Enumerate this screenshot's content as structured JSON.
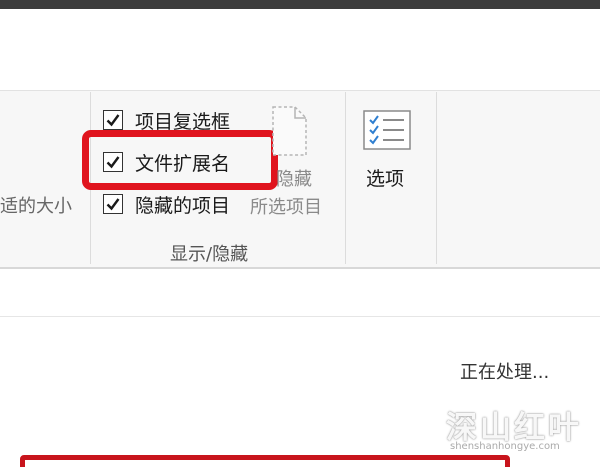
{
  "ribbon": {
    "partial_size_label": "适的大小",
    "show_hide_group": {
      "label": "显示/隐藏",
      "checkboxes": [
        {
          "label": "项目复选框",
          "checked": true
        },
        {
          "label": "文件扩展名",
          "checked": true,
          "highlighted": true
        },
        {
          "label": "隐藏的项目",
          "checked": true
        }
      ],
      "hide_selected": {
        "line1": "隐藏",
        "line2": "所选项目",
        "icon": "document-hide-icon"
      }
    },
    "options": {
      "label": "选项",
      "icon": "options-list-icon"
    }
  },
  "status": {
    "text": "正在处理..."
  },
  "watermark": {
    "text": "深山红叶",
    "url": "shenshanhongye.com"
  },
  "colors": {
    "highlight": "#e0141e",
    "ribbon_bg": "#f7f7f7",
    "top_band": "#3c3c3c"
  }
}
